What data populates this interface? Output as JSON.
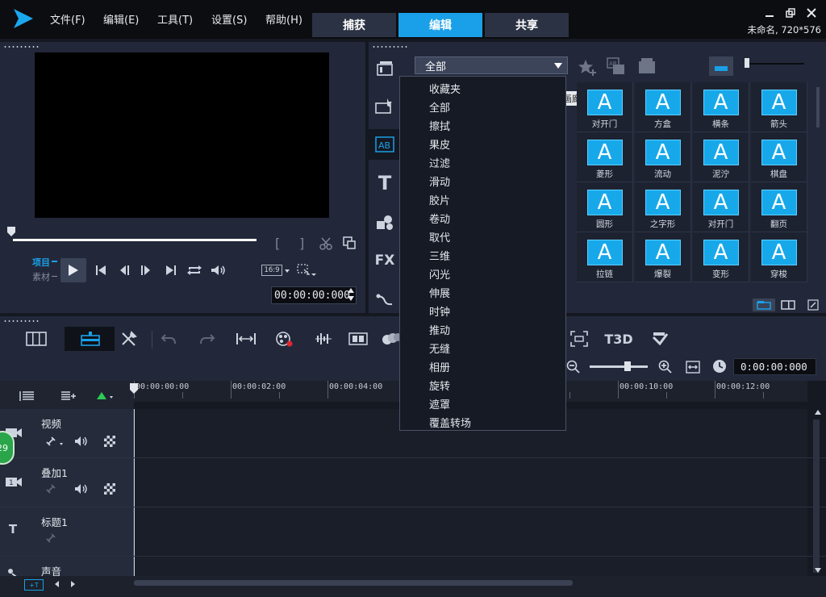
{
  "app": {
    "project_info": "未命名, 720*576"
  },
  "menu": [
    {
      "label": "文件(F)"
    },
    {
      "label": "编辑(E)"
    },
    {
      "label": "工具(T)"
    },
    {
      "label": "设置(S)"
    },
    {
      "label": "帮助(H)"
    }
  ],
  "tabs": [
    {
      "label": "捕获",
      "active": false
    },
    {
      "label": "编辑",
      "active": true
    },
    {
      "label": "共享",
      "active": false
    }
  ],
  "player": {
    "mode_project": "项目",
    "mode_clip": "素材",
    "aspect": "16:9",
    "timecode": "00:00:00:000"
  },
  "library": {
    "category_selected": "全部",
    "hidden_label_fragment": "画廊",
    "thumbnails": [
      {
        "label": "对开门"
      },
      {
        "label": "方盒"
      },
      {
        "label": "横条"
      },
      {
        "label": "箭头"
      },
      {
        "label": "菱形"
      },
      {
        "label": "流动"
      },
      {
        "label": "泥泞"
      },
      {
        "label": "棋盘"
      },
      {
        "label": "圆形"
      },
      {
        "label": "之字形"
      },
      {
        "label": "对开门"
      },
      {
        "label": "翻页"
      },
      {
        "label": "拉链"
      },
      {
        "label": "爆裂"
      },
      {
        "label": "变形"
      },
      {
        "label": "穿梭"
      }
    ],
    "thumb_glyph": "A"
  },
  "dropdown": {
    "items": [
      "收藏夹",
      "全部",
      "擦拭",
      "果皮",
      "过滤",
      "滑动",
      "胶片",
      "卷动",
      "取代",
      "三维",
      "闪光",
      "伸展",
      "时钟",
      "推动",
      "无缝",
      "相册",
      "旋转",
      "遮罩",
      "覆盖转场"
    ]
  },
  "timeline": {
    "timecode": "0:00:00:000",
    "ruler": [
      "00:00:00:00",
      "00:00:02:00",
      "00:00:04:00",
      "00:00:10:00",
      "00:00:12:00"
    ],
    "tracks": [
      {
        "name": "视频"
      },
      {
        "name": "叠加1"
      },
      {
        "name": "标题1"
      },
      {
        "name": "声音"
      }
    ],
    "badge_count": "29",
    "threed_label": "T3D"
  }
}
